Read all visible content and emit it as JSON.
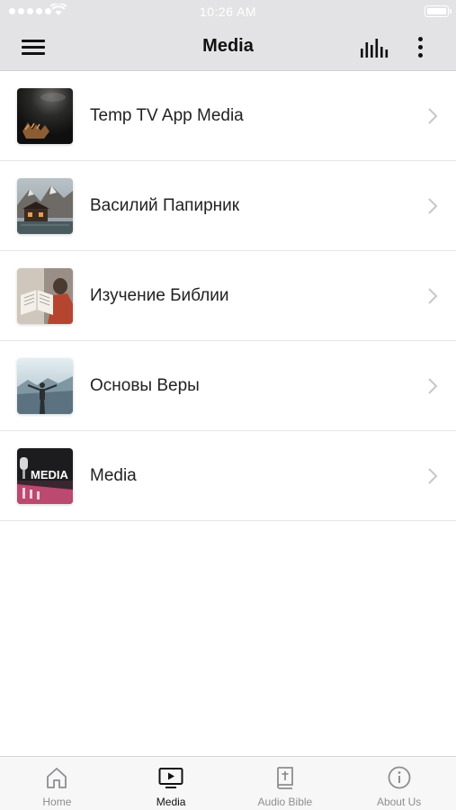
{
  "status_bar": {
    "time": "10:26 AM"
  },
  "nav": {
    "title": "Media"
  },
  "media_items": [
    {
      "label": "Temp TV App Media"
    },
    {
      "label": "Василий Папирник"
    },
    {
      "label": "Изучение Библии"
    },
    {
      "label": "Основы Веры"
    },
    {
      "label": "Media",
      "thumb_text": "MEDIA"
    }
  ],
  "tabs": [
    {
      "label": "Home",
      "icon": "home-icon",
      "active": false
    },
    {
      "label": "Media",
      "icon": "play-screen-icon",
      "active": true
    },
    {
      "label": "Audio Bible",
      "icon": "bible-icon",
      "active": false
    },
    {
      "label": "About Us",
      "icon": "info-icon",
      "active": false
    }
  ],
  "colors": {
    "bar_background": "#e3e3e5",
    "tab_active": "#111111",
    "tab_inactive": "#8e8e93"
  }
}
